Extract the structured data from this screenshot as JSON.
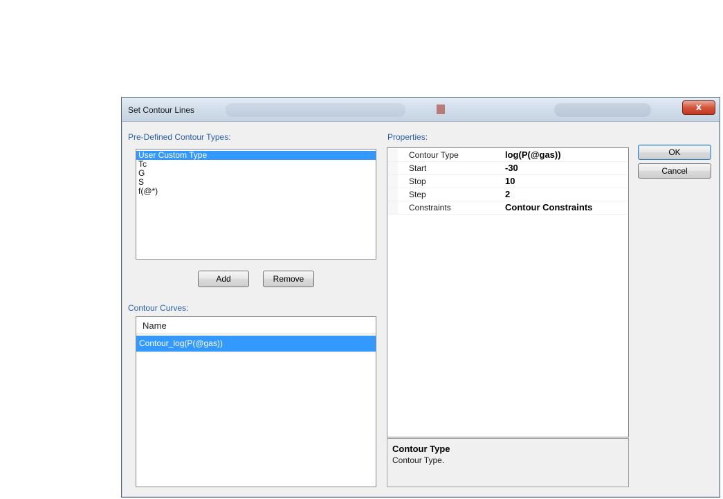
{
  "window": {
    "title": "Set Contour Lines",
    "close_glyph": "x"
  },
  "predefined": {
    "label": "Pre-Defined Contour Types:",
    "items": [
      "User Custom Type",
      "Tc",
      "G",
      "S",
      "f(@*)"
    ],
    "selected_index": 0,
    "add_label": "Add",
    "remove_label": "Remove"
  },
  "curves": {
    "label": "Contour Curves:",
    "column_header": "Name",
    "rows": [
      "Contour_log(P(@gas))"
    ]
  },
  "properties": {
    "label": "Properties:",
    "rows": [
      {
        "name": "Contour Type",
        "value": "log(P(@gas))"
      },
      {
        "name": "Start",
        "value": "-30"
      },
      {
        "name": "Stop",
        "value": "10"
      },
      {
        "name": "Step",
        "value": "2"
      },
      {
        "name": "Constraints",
        "value": "Contour Constraints"
      }
    ],
    "description": {
      "title": "Contour Type",
      "text": "Contour Type."
    }
  },
  "buttons": {
    "ok": "OK",
    "cancel": "Cancel"
  },
  "colors": {
    "selection": "#3399ff",
    "section_label": "#2a5fa8",
    "close_button": "#c0391f"
  }
}
